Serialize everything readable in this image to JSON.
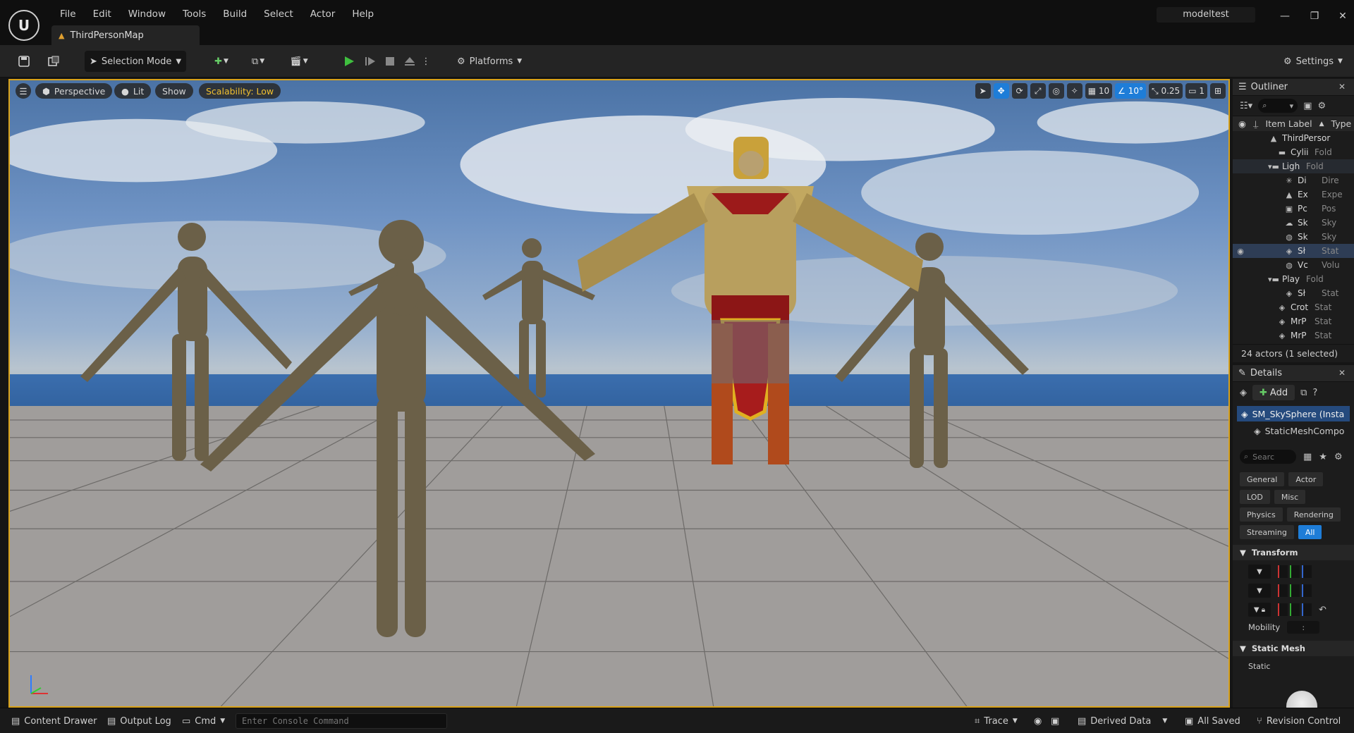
{
  "menu": [
    "File",
    "Edit",
    "Window",
    "Tools",
    "Build",
    "Select",
    "Actor",
    "Help"
  ],
  "logo": "U",
  "document_tab": "ThirdPersonMap",
  "project_name": "modeltest",
  "window_controls": [
    "—",
    "❐",
    "✕"
  ],
  "toolbar": {
    "selection_mode": "Selection Mode",
    "platforms": "Platforms",
    "settings": "Settings"
  },
  "viewport": {
    "perspective": "Perspective",
    "lit": "Lit",
    "show": "Show",
    "scalability": "Scalability: Low",
    "grid_snap": "10",
    "rotation_snap": "10°",
    "scale_snap": "0.25",
    "camera_speed": "1"
  },
  "outliner": {
    "title": "Outliner",
    "col_label": "Item Label",
    "col_type": "Type",
    "rows": [
      {
        "label": "ThirdPersor",
        "type": "",
        "indent": 50,
        "icon": "▲"
      },
      {
        "label": "Cylii",
        "type": "Fold",
        "indent": 62,
        "icon": "▬"
      },
      {
        "label": "Ligh",
        "type": "Fold",
        "indent": 50,
        "icon": "▾▬"
      },
      {
        "label": "Di",
        "type": "Dire",
        "indent": 72,
        "icon": "✳"
      },
      {
        "label": "Ex",
        "type": "Expe",
        "indent": 72,
        "icon": "▲"
      },
      {
        "label": "Pc",
        "type": "Pos",
        "indent": 72,
        "icon": "▣"
      },
      {
        "label": "Sk",
        "type": "Sky",
        "indent": 72,
        "icon": "☁"
      },
      {
        "label": "Sk",
        "type": "Sky",
        "indent": 72,
        "icon": "◍"
      },
      {
        "label": "Sł",
        "type": "Stat",
        "indent": 72,
        "icon": "◈"
      },
      {
        "label": "Vc",
        "type": "Volu",
        "indent": 72,
        "icon": "◍"
      },
      {
        "label": "Play",
        "type": "Fold",
        "indent": 50,
        "icon": "▾▬"
      },
      {
        "label": "Sł",
        "type": "Stat",
        "indent": 72,
        "icon": "◈"
      },
      {
        "label": "Crot",
        "type": "Stat",
        "indent": 62,
        "icon": "◈"
      },
      {
        "label": "MrP",
        "type": "Stat",
        "indent": 62,
        "icon": "◈"
      },
      {
        "label": "MrP",
        "type": "Stat",
        "indent": 62,
        "icon": "◈"
      }
    ],
    "footer": "24 actors (1 selected)"
  },
  "details": {
    "title": "Details",
    "add": "Add",
    "root_component": "SM_SkySphere (Insta",
    "child_component": "StaticMeshCompo",
    "search_placeholder": "Searc",
    "filters": [
      "General",
      "Actor",
      "LOD",
      "Misc",
      "Physics",
      "Rendering",
      "Streaming",
      "All"
    ],
    "transform": "Transform",
    "mobility_label": "Mobility",
    "mobility_value": ":",
    "static_mesh": "Static Mesh",
    "static_label": "Static"
  },
  "statusbar": {
    "content_drawer": "Content Drawer",
    "output_log": "Output Log",
    "cmd": "Cmd",
    "console_placeholder": "Enter Console Command",
    "trace": "Trace",
    "derived_data": "Derived Data",
    "all_saved": "All Saved",
    "revision_control": "Revision Control"
  },
  "colors": {
    "accent": "#1e7dd8",
    "viewport_border": "#d9a21a",
    "play_green": "#3fbf3f"
  }
}
